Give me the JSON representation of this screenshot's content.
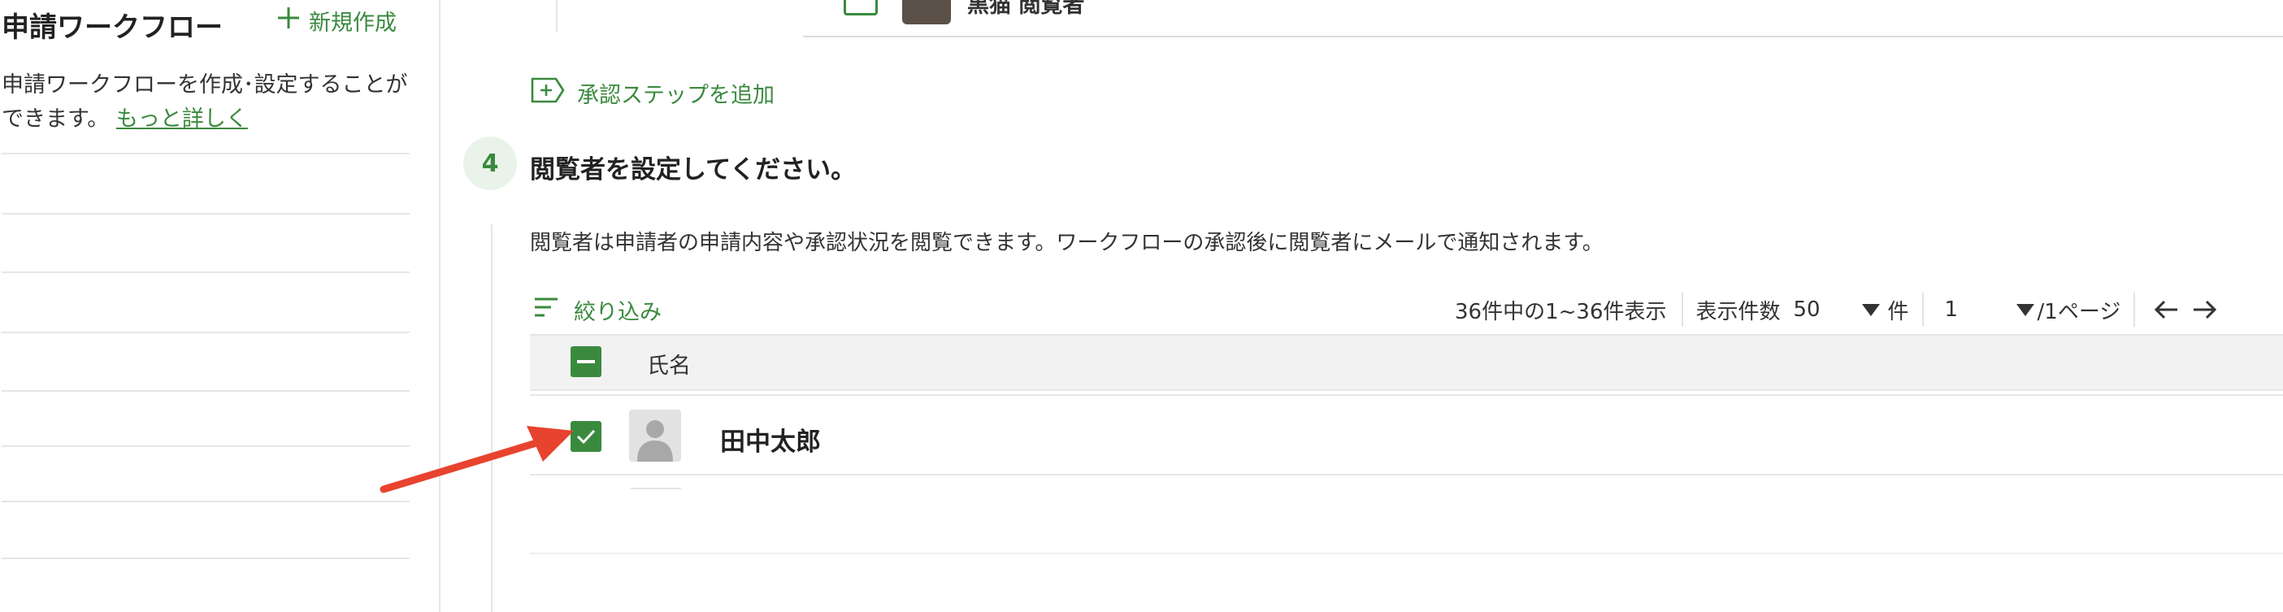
{
  "sidebar": {
    "title": "申請ワークフロー",
    "new_label": "新規作成",
    "description": "申請ワークフローを作成･設定することができます。",
    "more_link": "もっと詳しく"
  },
  "top_card": {
    "viewer_text": "黒猫 閲覧者"
  },
  "add_step_label": "承認ステップを追加",
  "step": {
    "number": "4",
    "title": "閲覧者を設定してください。",
    "description": "閲覧者は申請者の申請内容や承認状況を閲覧できます。ワークフローの承認後に閲覧者にメールで通知されます。"
  },
  "toolbar": {
    "filter_label": "絞り込み",
    "range_text": "36件中の1~36件表示",
    "per_page_label": "表示件数",
    "per_page_value": "50",
    "per_page_unit": "件",
    "page_value": "1",
    "page_suffix": "/1ページ"
  },
  "table": {
    "header_name": "氏名",
    "rows": [
      {
        "name": "田中太郎",
        "checked": true
      }
    ]
  },
  "colors": {
    "accent": "#3a8a3e",
    "annotation_arrow": "#e8432f"
  },
  "icons": [
    "plus-icon",
    "add-step-icon",
    "filter-icon",
    "dropdown-triangle-icon",
    "arrow-left-icon",
    "arrow-right-icon",
    "checkbox-check-icon",
    "user-avatar-icon"
  ]
}
